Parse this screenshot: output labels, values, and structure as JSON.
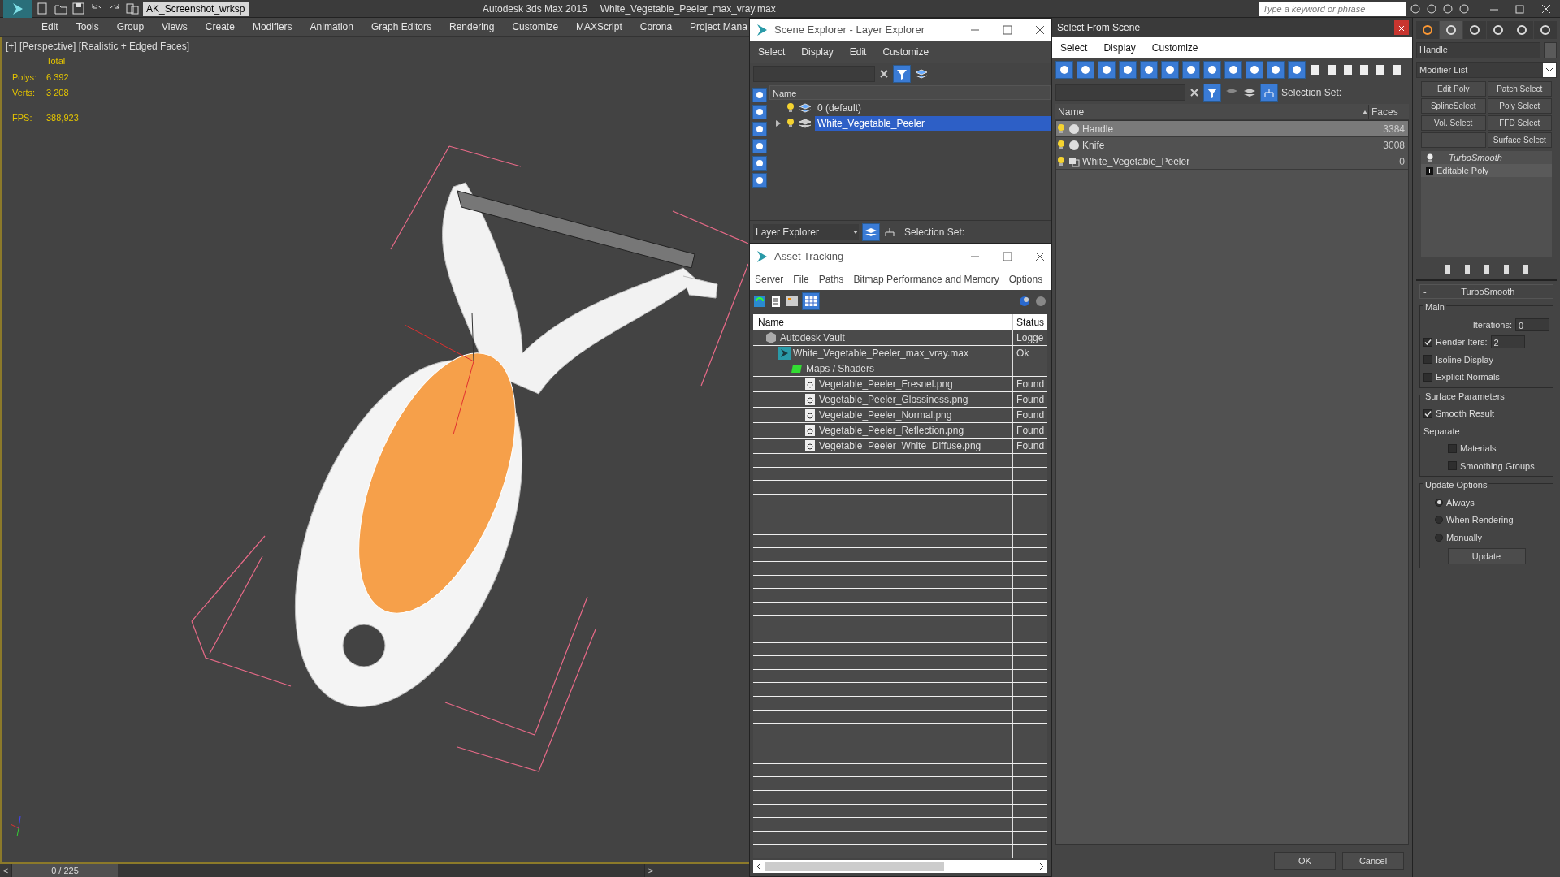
{
  "title_bar": {
    "workspace": "AK_Screenshot_wrksp",
    "app_title": "Autodesk 3ds Max  2015",
    "file_title": "White_Vegetable_Peeler_max_vray.max",
    "search": {
      "placeholder": "Type a keyword or phrase"
    }
  },
  "menu_bar": [
    "Edit",
    "Tools",
    "Group",
    "Views",
    "Create",
    "Modifiers",
    "Animation",
    "Graph Editors",
    "Rendering",
    "Customize",
    "MAXScript",
    "Corona",
    "Project Mana"
  ],
  "viewport": {
    "label": "[+] [Perspective] [Realistic + Edged Faces]",
    "stats_header": "Total",
    "stats": [
      {
        "label": "Polys:",
        "value": "6 392"
      },
      {
        "label": "Verts:",
        "value": "3 208"
      }
    ],
    "fps_label": "FPS:",
    "fps": "388,923"
  },
  "timeline": {
    "prev": "<",
    "position": "0 / 225",
    "level": 0,
    "next": ">"
  },
  "scene_explorer": {
    "title": "Scene Explorer - Layer Explorer",
    "menu": [
      "Select",
      "Display",
      "Edit",
      "Customize"
    ],
    "column": "Name",
    "layers": [
      {
        "name": "0 (default)",
        "selected": false,
        "expandable": false
      },
      {
        "name": "White_Vegetable_Peeler",
        "selected": true,
        "expandable": true
      }
    ],
    "explorer": "Layer Explorer",
    "selection_set": "Selection Set:"
  },
  "asset_tracking": {
    "title": "Asset Tracking",
    "menu": [
      "Server",
      "File",
      "Paths",
      "Bitmap Performance and Memory",
      "Options"
    ],
    "columns": [
      "Name",
      "Status"
    ],
    "rows": [
      {
        "kind": "vault",
        "name": "Autodesk Vault",
        "status": "Logge",
        "children": [
          {
            "kind": "scene",
            "name": "White_Vegetable_Peeler_max_vray.max",
            "status": "Ok",
            "children": [
              {
                "kind": "maps",
                "name": "Maps / Shaders",
                "children": [
                  {
                    "kind": "bitmap",
                    "name": "Vegetable_Peeler_Fresnel.png",
                    "status": "Found"
                  },
                  {
                    "kind": "bitmap",
                    "name": "Vegetable_Peeler_Glossiness.png",
                    "status": "Found"
                  },
                  {
                    "kind": "bitmap",
                    "name": "Vegetable_Peeler_Normal.png",
                    "status": "Found"
                  },
                  {
                    "kind": "bitmap",
                    "name": "Vegetable_Peeler_Reflection.png",
                    "status": "Found"
                  },
                  {
                    "kind": "bitmap",
                    "name": "Vegetable_Peeler_White_Diffuse.png",
                    "status": "Found"
                  }
                ]
              }
            ]
          }
        ]
      }
    ]
  },
  "select_from_scene": {
    "title": "Select From Scene",
    "menu": [
      "Select",
      "Display",
      "Customize"
    ],
    "selection_set": "Selection Set:",
    "columns": [
      "Name",
      "Faces"
    ],
    "rows": [
      {
        "kind": "geometry",
        "name": "Handle",
        "faces": "3384",
        "selected": true
      },
      {
        "kind": "geometry",
        "name": "Knife",
        "faces": "3008",
        "selected": false
      },
      {
        "kind": "group",
        "name": "White_Vegetable_Peeler",
        "faces": "0",
        "selected": false
      }
    ],
    "buttons": [
      "OK",
      "Cancel"
    ]
  },
  "command_panel": {
    "object_name": "Handle",
    "modifier_list": "Modifier List",
    "modifier_buttons": [
      {
        "kind": "label",
        "label": "Edit Poly"
      },
      {
        "kind": "label",
        "label": "Patch Select"
      },
      {
        "kind": "label",
        "label": "SplineSelect"
      },
      {
        "kind": "label",
        "label": "Poly Select"
      },
      {
        "kind": "label",
        "label": "Vol. Select"
      },
      {
        "kind": "label",
        "label": "FFD Select"
      },
      {
        "kind": "blank"
      },
      {
        "kind": "label",
        "label": "Surface Select"
      }
    ],
    "stack": [
      {
        "kind": "modifier",
        "name": "TurboSmooth"
      },
      {
        "kind": "base",
        "name": "Editable Poly"
      }
    ],
    "rollout": {
      "collapse": "-",
      "title": "TurboSmooth",
      "main": {
        "title": "Main",
        "iterations_label": "Iterations:",
        "iterations": "0",
        "render_iters_label": "Render Iters:",
        "render_iters": "2",
        "render_iters_checked": true,
        "checks": [
          {
            "label": "Isoline Display",
            "checked": false
          },
          {
            "label": "Explicit Normals",
            "checked": false
          }
        ]
      },
      "surface": {
        "title": "Surface Parameters",
        "smooth_result": {
          "label": "Smooth Result",
          "checked": true
        },
        "separate": "Separate",
        "checks": [
          {
            "label": "Materials",
            "checked": false
          },
          {
            "label": "Smoothing Groups",
            "checked": false
          }
        ]
      },
      "update": {
        "title": "Update Options",
        "options": [
          {
            "label": "Always",
            "selected": true
          },
          {
            "label": "When Rendering",
            "selected": false
          },
          {
            "label": "Manually",
            "selected": false
          }
        ],
        "button": "Update"
      }
    }
  }
}
